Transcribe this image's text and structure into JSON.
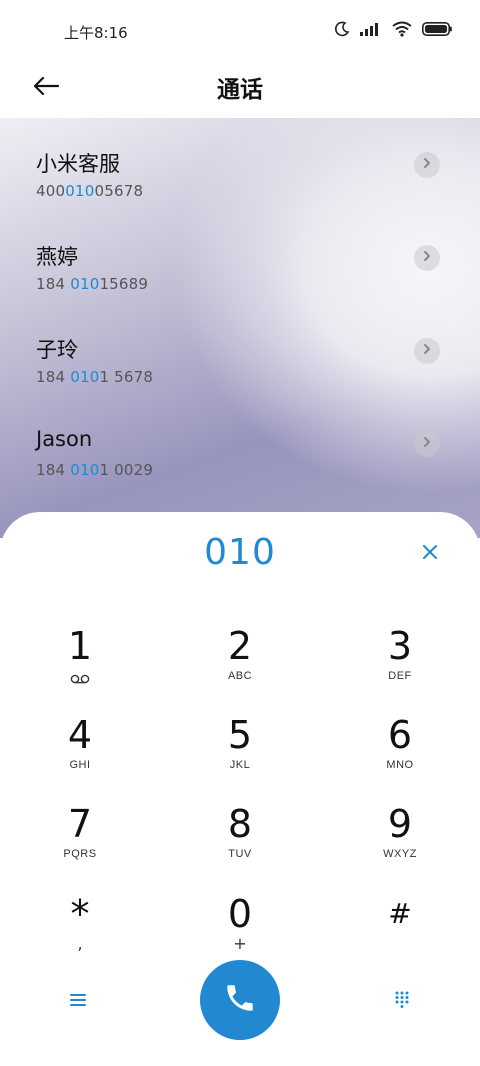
{
  "status": {
    "time": "上午8:16",
    "icons": [
      "moon-icon",
      "signal-icon",
      "wifi-icon",
      "battery-icon"
    ]
  },
  "header": {
    "title": "通话",
    "back_icon": "arrow-left-icon"
  },
  "contacts": [
    {
      "name": "小米客服",
      "number_pre": "400",
      "number_hl": "010",
      "number_post": "05678"
    },
    {
      "name": "燕婷",
      "number_pre": "184 ",
      "number_hl": "010",
      "number_post": "15689"
    },
    {
      "name": "子玲",
      "number_pre": "184 ",
      "number_hl": "010",
      "number_post": "1 5678"
    },
    {
      "name": "Jason",
      "number_pre": "184 ",
      "number_hl": "010",
      "number_post": "1 0029"
    }
  ],
  "dialer": {
    "input_value": "010",
    "clear_icon": "close-icon",
    "keys": [
      {
        "digit": "1",
        "letters": "",
        "icon": "voicemail-icon"
      },
      {
        "digit": "2",
        "letters": "ABC"
      },
      {
        "digit": "3",
        "letters": "DEF"
      },
      {
        "digit": "4",
        "letters": "GHI"
      },
      {
        "digit": "5",
        "letters": "JKL"
      },
      {
        "digit": "6",
        "letters": "MNO"
      },
      {
        "digit": "7",
        "letters": "PQRS"
      },
      {
        "digit": "8",
        "letters": "TUV"
      },
      {
        "digit": "9",
        "letters": "WXYZ"
      },
      {
        "digit": "*",
        "letters": ","
      },
      {
        "digit": "0",
        "letters": "+"
      },
      {
        "digit": "#",
        "letters": ""
      }
    ],
    "bottom": {
      "menu_icon": "menu-icon",
      "call_icon": "phone-icon",
      "keypad_icon": "dialpad-icon"
    }
  },
  "colors": {
    "accent": "#1f8ad2",
    "call_button": "#2188d1"
  }
}
